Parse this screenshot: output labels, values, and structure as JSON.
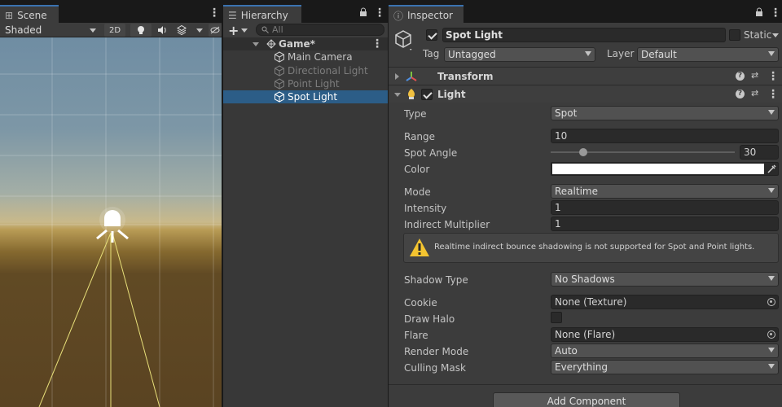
{
  "scene": {
    "tab_label": "Scene",
    "shading_mode": "Shaded",
    "toggle_2d": "2D"
  },
  "hierarchy": {
    "tab_label": "Hierarchy",
    "search_placeholder": "All",
    "scene_name": "Game*",
    "items": [
      {
        "label": "Main Camera",
        "state": "normal"
      },
      {
        "label": "Directional Light",
        "state": "disabled"
      },
      {
        "label": "Point Light",
        "state": "disabled"
      },
      {
        "label": "Spot Light",
        "state": "selected"
      }
    ]
  },
  "inspector": {
    "tab_label": "Inspector",
    "object_name": "Spot Light",
    "object_active": true,
    "static_label": "Static",
    "static": false,
    "tag_label": "Tag",
    "tag_value": "Untagged",
    "layer_label": "Layer",
    "layer_value": "Default",
    "transform": {
      "title": "Transform",
      "expanded": false
    },
    "light": {
      "title": "Light",
      "enabled": true,
      "expanded": true,
      "type_label": "Type",
      "type_value": "Spot",
      "range_label": "Range",
      "range_value": "10",
      "spot_angle_label": "Spot Angle",
      "spot_angle_value": "30",
      "spot_angle_min": 1,
      "spot_angle_max": 179,
      "color_label": "Color",
      "color_value": "#ffffff",
      "mode_label": "Mode",
      "mode_value": "Realtime",
      "intensity_label": "Intensity",
      "intensity_value": "1",
      "indirect_label": "Indirect Multiplier",
      "indirect_value": "1",
      "warning_text": "Realtime indirect bounce shadowing is not supported for Spot and Point lights.",
      "shadow_type_label": "Shadow Type",
      "shadow_type_value": "No Shadows",
      "cookie_label": "Cookie",
      "cookie_value": "None (Texture)",
      "draw_halo_label": "Draw Halo",
      "draw_halo": false,
      "flare_label": "Flare",
      "flare_value": "None (Flare)",
      "render_mode_label": "Render Mode",
      "render_mode_value": "Auto",
      "culling_mask_label": "Culling Mask",
      "culling_mask_value": "Everything"
    },
    "add_component_label": "Add Component"
  },
  "colors": {
    "selection": "#2c5d87",
    "tab_accent": "#3a72b0",
    "warning": "#f4c430",
    "spot_cone": "#e8e07a"
  }
}
